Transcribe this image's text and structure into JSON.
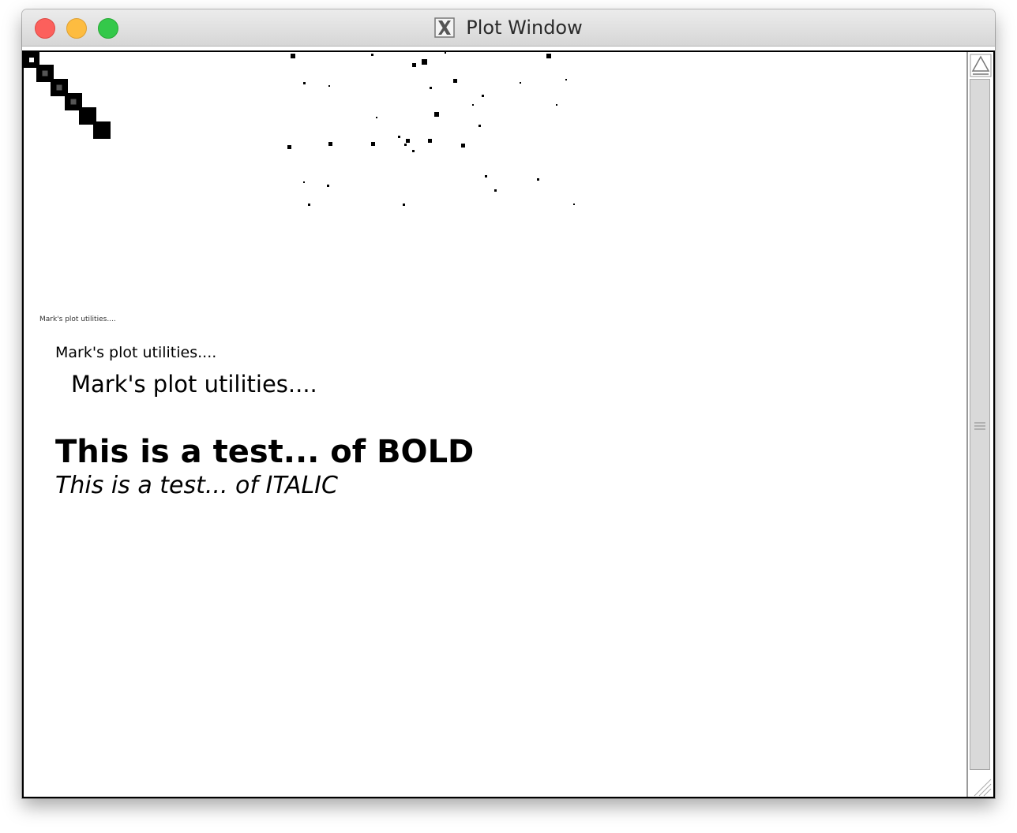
{
  "window": {
    "title": "Plot Window",
    "title_icon": "x11-icon"
  },
  "plot": {
    "text_tiny": "Mark's plot utilities....",
    "text_small": "Mark's plot utilities....",
    "text_medium": "Mark's plot utilities....",
    "text_bold": "This is a test... of BOLD",
    "text_italic": "This is a test... of ITALIC"
  },
  "scrollbar": {
    "up_icon": "scroll-up-arrow-icon",
    "thumb_icon": "scroll-thumb-grip-icon",
    "resize_icon": "resize-grip-icon"
  },
  "colors": {
    "close": "#fc605c",
    "minimize": "#fdbc40",
    "maximize": "#34c84a",
    "ink": "#000000",
    "dark_gray": "#555555"
  }
}
